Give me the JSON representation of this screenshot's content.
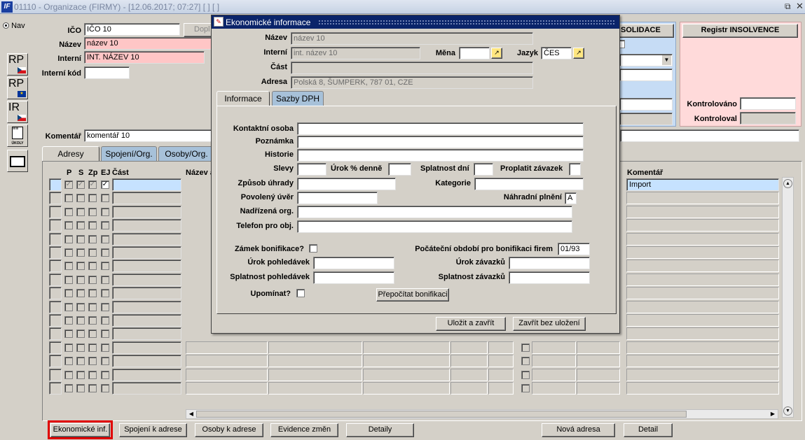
{
  "titlebar": {
    "logo": "IF",
    "title": "01110 - Organizace (FIRMY) - [12.06.2017; 07:27]  [ ]  [ ]",
    "restore_icon": "restore-icon",
    "close_icon": "close-icon"
  },
  "nav": {
    "label": "Nav"
  },
  "sidebar": {
    "rp1": "RP",
    "rp2": "RP",
    "ir": "IR",
    "ukoly": "ÚKOLY"
  },
  "form": {
    "ico_label": "IČO",
    "ico_value": "IČO 10",
    "dopl_label": "Dopl",
    "nazev_label": "Název",
    "nazev_value": "název 10",
    "interni_label": "Interní",
    "interni_value": "INT. NÁZEV 10",
    "interni_kod_label": "Interní kód",
    "interni_kod_value": "",
    "komentar_label": "Komentář",
    "komentar_value": "komentář 10"
  },
  "right_panels": {
    "solidace": "SOLIDACE",
    "insolvence": "Registr INSOLVENCE",
    "kontrolovano": "Kontrolováno",
    "kontroloval": "Kontroloval"
  },
  "main_tabs": [
    "Adresy",
    "Spojení/Org.",
    "Osoby/Org."
  ],
  "grid": {
    "headers": {
      "p": "P",
      "s": "S",
      "zp": "Zp",
      "ej": "EJ",
      "cast": "Část",
      "nazev": "Název a",
      "komentar": "Komentář"
    },
    "first_row_komentar": "Import"
  },
  "bottom_buttons": [
    "Ekonomické inf.",
    "Spojení k adrese",
    "Osoby k adrese",
    "Evidence změn",
    "Detaily",
    "Nová adresa",
    "Detail"
  ],
  "dialog": {
    "title": "Ekonomické informace",
    "nazev_label": "Název",
    "nazev_value": "název 10",
    "interni_label": "Interní",
    "interni_value": "int. název 10",
    "mena_label": "Měna",
    "mena_value": "",
    "jazyk_label": "Jazyk",
    "jazyk_value": "ČES",
    "cast_label": "Část",
    "cast_value": "",
    "adresa_label": "Adresa",
    "adresa_value": "Polská 8, ŠUMPERK, 787 01, CZE",
    "tabs": [
      "Informace",
      "Sazby DPH"
    ],
    "fields": {
      "kontaktni_osoba": "Kontaktní osoba",
      "poznamka": "Poznámka",
      "historie": "Historie",
      "slevy": "Slevy",
      "urok_denne": "Úrok % denně",
      "splatnost_dni": "Splatnost dní",
      "proplatit_zavazek": "Proplatit závazek",
      "zpusob_uhrady": "Způsob úhrady",
      "kategorie": "Kategorie",
      "povoleny_uver": "Povolený úvěr",
      "nahradni_plneni": "Náhradní plnění",
      "nahradni_plneni_value": "A",
      "nadrizena_org": "Nadřízená org.",
      "telefon_pro_obj": "Telefon pro obj.",
      "zamek_bonifikace": "Zámek bonifikace?",
      "pocatecni_obdobi": "Počáteční období pro bonifikaci firem",
      "pocatecni_obdobi_value": "01/93",
      "urok_pohledavek": "Úrok pohledávek",
      "urok_zavazku": "Úrok závazků",
      "splatnost_pohledavek": "Splatnost pohledávek",
      "splatnost_zavazku": "Splatnost závazků",
      "upominat": "Upomínat?"
    },
    "prepocitat_label": "Přepočítat bonifikaci",
    "ulozit_label": "Uložit a zavřít",
    "zavrit_label": "Zavřít bez uložení"
  },
  "colors": {
    "highlight_red": "#e00000",
    "pink_field": "#ffc6c6",
    "title_blue": "#0a246a"
  }
}
